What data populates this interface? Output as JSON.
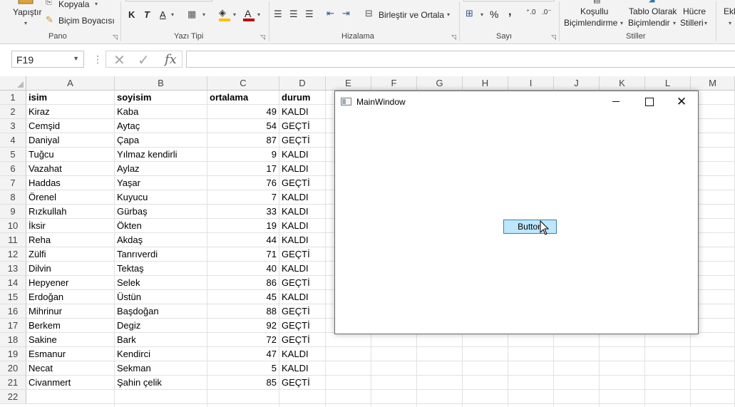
{
  "ribbon": {
    "paste_label": "Yapıştır",
    "copy_label": "Kopyala",
    "format_painter_label": "Biçim Boyacısı",
    "groups": [
      "Pano",
      "Yazı Tipi",
      "Hizalama",
      "Sayı",
      "Stiller"
    ],
    "bold": "K",
    "italic": "T",
    "underline": "A",
    "font_color": "A",
    "merge_center_label": "Birleştir ve Ortala",
    "percent": "%",
    "comma": ",",
    "conditional_formatting_label": [
      "Koşullu",
      "Biçimlendirme"
    ],
    "format_as_table_label": [
      "Tablo Olarak",
      "Biçimlendir"
    ],
    "cell_styles_label": [
      "Hücre",
      "Stilleri"
    ],
    "insert_label": "Ekl"
  },
  "formula_bar": {
    "name_box": "F19",
    "fx": "fx",
    "content": ""
  },
  "columns": [
    "A",
    "B",
    "C",
    "D",
    "E",
    "F",
    "G",
    "H",
    "I",
    "J",
    "K",
    "L",
    "M"
  ],
  "rows": [
    {
      "n": "1",
      "a": "isim",
      "b": "soyisim",
      "c": "ortalama",
      "d": "durum"
    },
    {
      "n": "2",
      "a": "Kiraz",
      "b": "Kaba",
      "c": "49",
      "d": "KALDI"
    },
    {
      "n": "3",
      "a": "Cemşid",
      "b": "Aytaç",
      "c": "54",
      "d": "GEÇTİ"
    },
    {
      "n": "4",
      "a": "Daniyal",
      "b": "Çapa",
      "c": "87",
      "d": "GEÇTİ"
    },
    {
      "n": "5",
      "a": "Tuğcu",
      "b": "Yılmaz kendirli",
      "c": "9",
      "d": "KALDI"
    },
    {
      "n": "6",
      "a": "Vazahat",
      "b": "Aylaz",
      "c": "17",
      "d": "KALDI"
    },
    {
      "n": "7",
      "a": "Haddas",
      "b": "Yaşar",
      "c": "76",
      "d": "GEÇTİ"
    },
    {
      "n": "8",
      "a": "Örenel",
      "b": "Kuyucu",
      "c": "7",
      "d": "KALDI"
    },
    {
      "n": "9",
      "a": "Rızkullah",
      "b": "Gürbaş",
      "c": "33",
      "d": "KALDI"
    },
    {
      "n": "10",
      "a": "İksir",
      "b": "Ökten",
      "c": "19",
      "d": "KALDI"
    },
    {
      "n": "11",
      "a": "Reha",
      "b": "Akdaş",
      "c": "44",
      "d": "KALDI"
    },
    {
      "n": "12",
      "a": "Zülfi",
      "b": "Tanrıverdi",
      "c": "71",
      "d": "GEÇTİ"
    },
    {
      "n": "13",
      "a": "Dilvin",
      "b": "Tektaş",
      "c": "40",
      "d": "KALDI"
    },
    {
      "n": "14",
      "a": "Hepyener",
      "b": "Selek",
      "c": "86",
      "d": "GEÇTİ"
    },
    {
      "n": "15",
      "a": "Erdoğan",
      "b": "Üstün",
      "c": "45",
      "d": "KALDI"
    },
    {
      "n": "16",
      "a": "Mihrinur",
      "b": "Başdoğan",
      "c": "88",
      "d": "GEÇTİ"
    },
    {
      "n": "17",
      "a": "Berkem",
      "b": "Degiz",
      "c": "92",
      "d": "GEÇTİ"
    },
    {
      "n": "18",
      "a": "Sakine",
      "b": "Bark",
      "c": "72",
      "d": "GEÇTİ"
    },
    {
      "n": "19",
      "a": "Esmanur",
      "b": "Kendirci",
      "c": "47",
      "d": "KALDI"
    },
    {
      "n": "20",
      "a": "Necat",
      "b": "Sekman",
      "c": "5",
      "d": "KALDI"
    },
    {
      "n": "21",
      "a": "Civanmert",
      "b": "Şahin çelik",
      "c": "85",
      "d": "GEÇTİ"
    },
    {
      "n": "22",
      "a": "",
      "b": "",
      "c": "",
      "d": ""
    }
  ],
  "window": {
    "title": "MainWindow",
    "button_label": "Button"
  }
}
